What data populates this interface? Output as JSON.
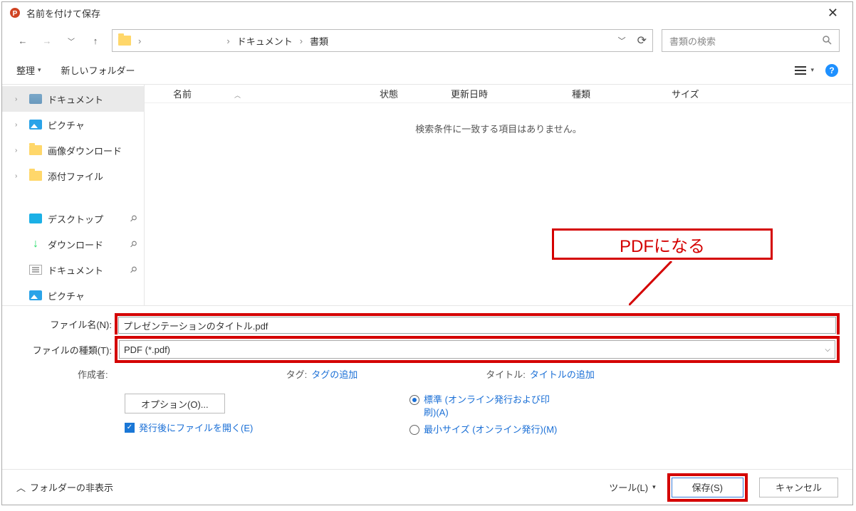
{
  "window": {
    "title": "名前を付けて保存"
  },
  "nav": {
    "crumb1": "ドキュメント",
    "crumb2": "書類",
    "search_placeholder": "書類の検索"
  },
  "toolbar": {
    "organize": "整理",
    "newfolder": "新しいフォルダー"
  },
  "tree": {
    "documents": "ドキュメント",
    "pictures": "ピクチャ",
    "imgdl": "画像ダウンロード",
    "attach": "添付ファイル",
    "desktop": "デスクトップ",
    "downloads": "ダウンロード",
    "documents2": "ドキュメント",
    "pictures2": "ピクチャ"
  },
  "columns": {
    "name": "名前",
    "state": "状態",
    "date": "更新日時",
    "kind": "種類",
    "size": "サイズ"
  },
  "list": {
    "empty": "検索条件に一致する項目はありません。"
  },
  "annotation": {
    "text": "PDFになる"
  },
  "fields": {
    "filename_label": "ファイル名(N):",
    "filename_value": "プレゼンテーションのタイトル.pdf",
    "filetype_label": "ファイルの種類(T):",
    "filetype_value": "PDF (*.pdf)",
    "author_label": "作成者:",
    "tag_label": "タグ:",
    "tag_value": "タグの追加",
    "title_label": "タイトル:",
    "title_value": "タイトルの追加"
  },
  "options": {
    "button": "オプション(O)...",
    "open_after": "発行後にファイルを開く(E)",
    "standard": "標準 (オンライン発行および印刷)(A)",
    "minimum": "最小サイズ (オンライン発行)(M)"
  },
  "footer": {
    "hide_folders": "フォルダーの非表示",
    "tools": "ツール(L)",
    "save": "保存(S)",
    "cancel": "キャンセル"
  }
}
